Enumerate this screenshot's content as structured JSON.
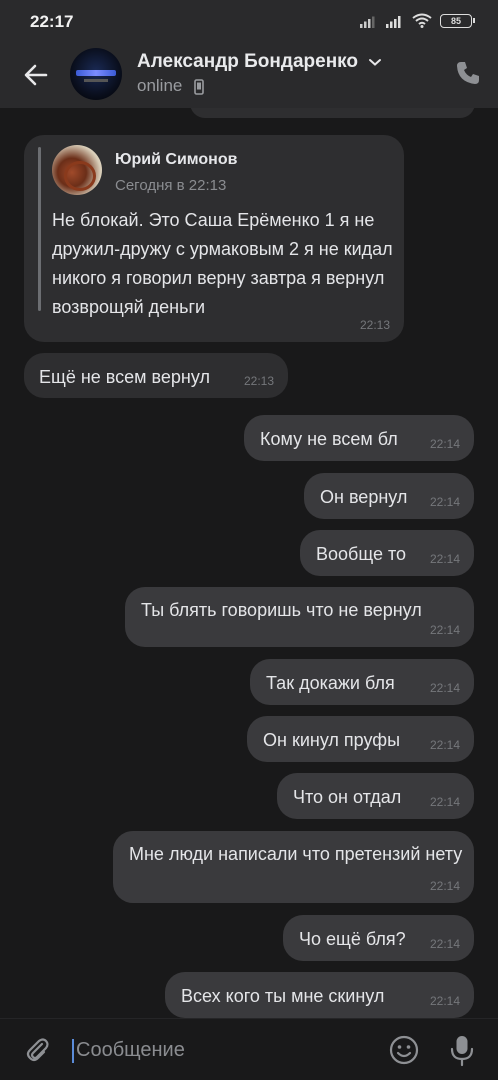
{
  "status_bar": {
    "time": "22:17",
    "battery": "85",
    "icons": [
      "signal-icon",
      "signal-icon",
      "wifi-icon",
      "battery-icon"
    ]
  },
  "header": {
    "name": "Александр Бондаренко",
    "status": "online",
    "icons": [
      "back-arrow-icon",
      "chevron-down-icon",
      "mobile-phone-icon",
      "call-icon"
    ]
  },
  "chat": {
    "forwarded": {
      "author": "Юрий Симонов",
      "date": "Сегодня в 22:13",
      "text": "Не блокай. Это Саша Ерёменко 1 я не дружил-дружу с урмаковым 2 я не кидал никого я говорил верну завтра я вернул возврощяй деньги",
      "time": "22:13"
    },
    "messages": [
      {
        "dir": "in",
        "text": "Ещё не всем вернул",
        "time": "22:13"
      },
      {
        "dir": "out",
        "text": "Кому не всем бл",
        "time": "22:14"
      },
      {
        "dir": "out",
        "text": "Он вернул",
        "time": "22:14"
      },
      {
        "dir": "out",
        "text": "Вообще то",
        "time": "22:14"
      },
      {
        "dir": "out",
        "text": "Ты блять говоришь что не вернул",
        "time": "22:14"
      },
      {
        "dir": "out",
        "text": "Так докажи бля",
        "time": "22:14"
      },
      {
        "dir": "out",
        "text": "Он кинул пруфы",
        "time": "22:14"
      },
      {
        "dir": "out",
        "text": "Что он отдал",
        "time": "22:14"
      },
      {
        "dir": "out",
        "text": "Мне люди написали что претензий нету",
        "time": "22:14"
      },
      {
        "dir": "out",
        "text": "Чо ещё бля?",
        "time": "22:14"
      },
      {
        "dir": "out",
        "text": "Всех кого ты мне скинул",
        "time": "22:14"
      }
    ]
  },
  "input": {
    "placeholder": "Сообщение",
    "icons": [
      "attach-icon",
      "emoji-icon",
      "microphone-icon"
    ]
  },
  "colors": {
    "background": "#19191a",
    "header": "#2a2a2c",
    "incoming_bubble": "#2e2e30",
    "outgoing_bubble": "#3a3a3d",
    "cursor_accent": "#5b8cd9"
  }
}
